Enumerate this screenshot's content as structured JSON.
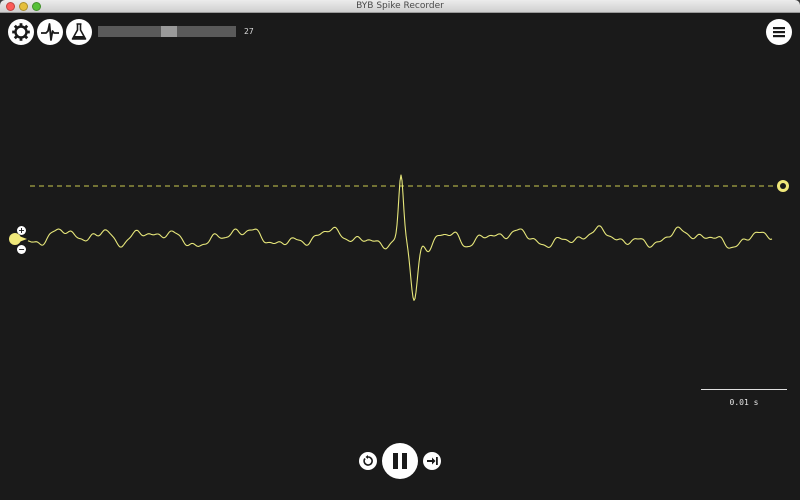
{
  "window": {
    "title": "BYB Spike Recorder"
  },
  "toolbar": {
    "config_icon": "gear-icon",
    "threshold_icon": "spike-icon",
    "analysis_icon": "flask-icon",
    "menu_icon": "menu-icon"
  },
  "level": {
    "value": "27",
    "fraction": 0.52
  },
  "gain": {
    "plus": "+",
    "minus": "−"
  },
  "scale": {
    "label": "0.01 s"
  },
  "colors": {
    "trace": "#e6e67a",
    "background": "#1a1a1a",
    "threshold": "#c9c94f",
    "handle": "#f0e87a"
  },
  "playback": {
    "rewind_icon": "rewind-icon",
    "pause_icon": "pause-icon",
    "forward_icon": "skip-forward-icon"
  }
}
